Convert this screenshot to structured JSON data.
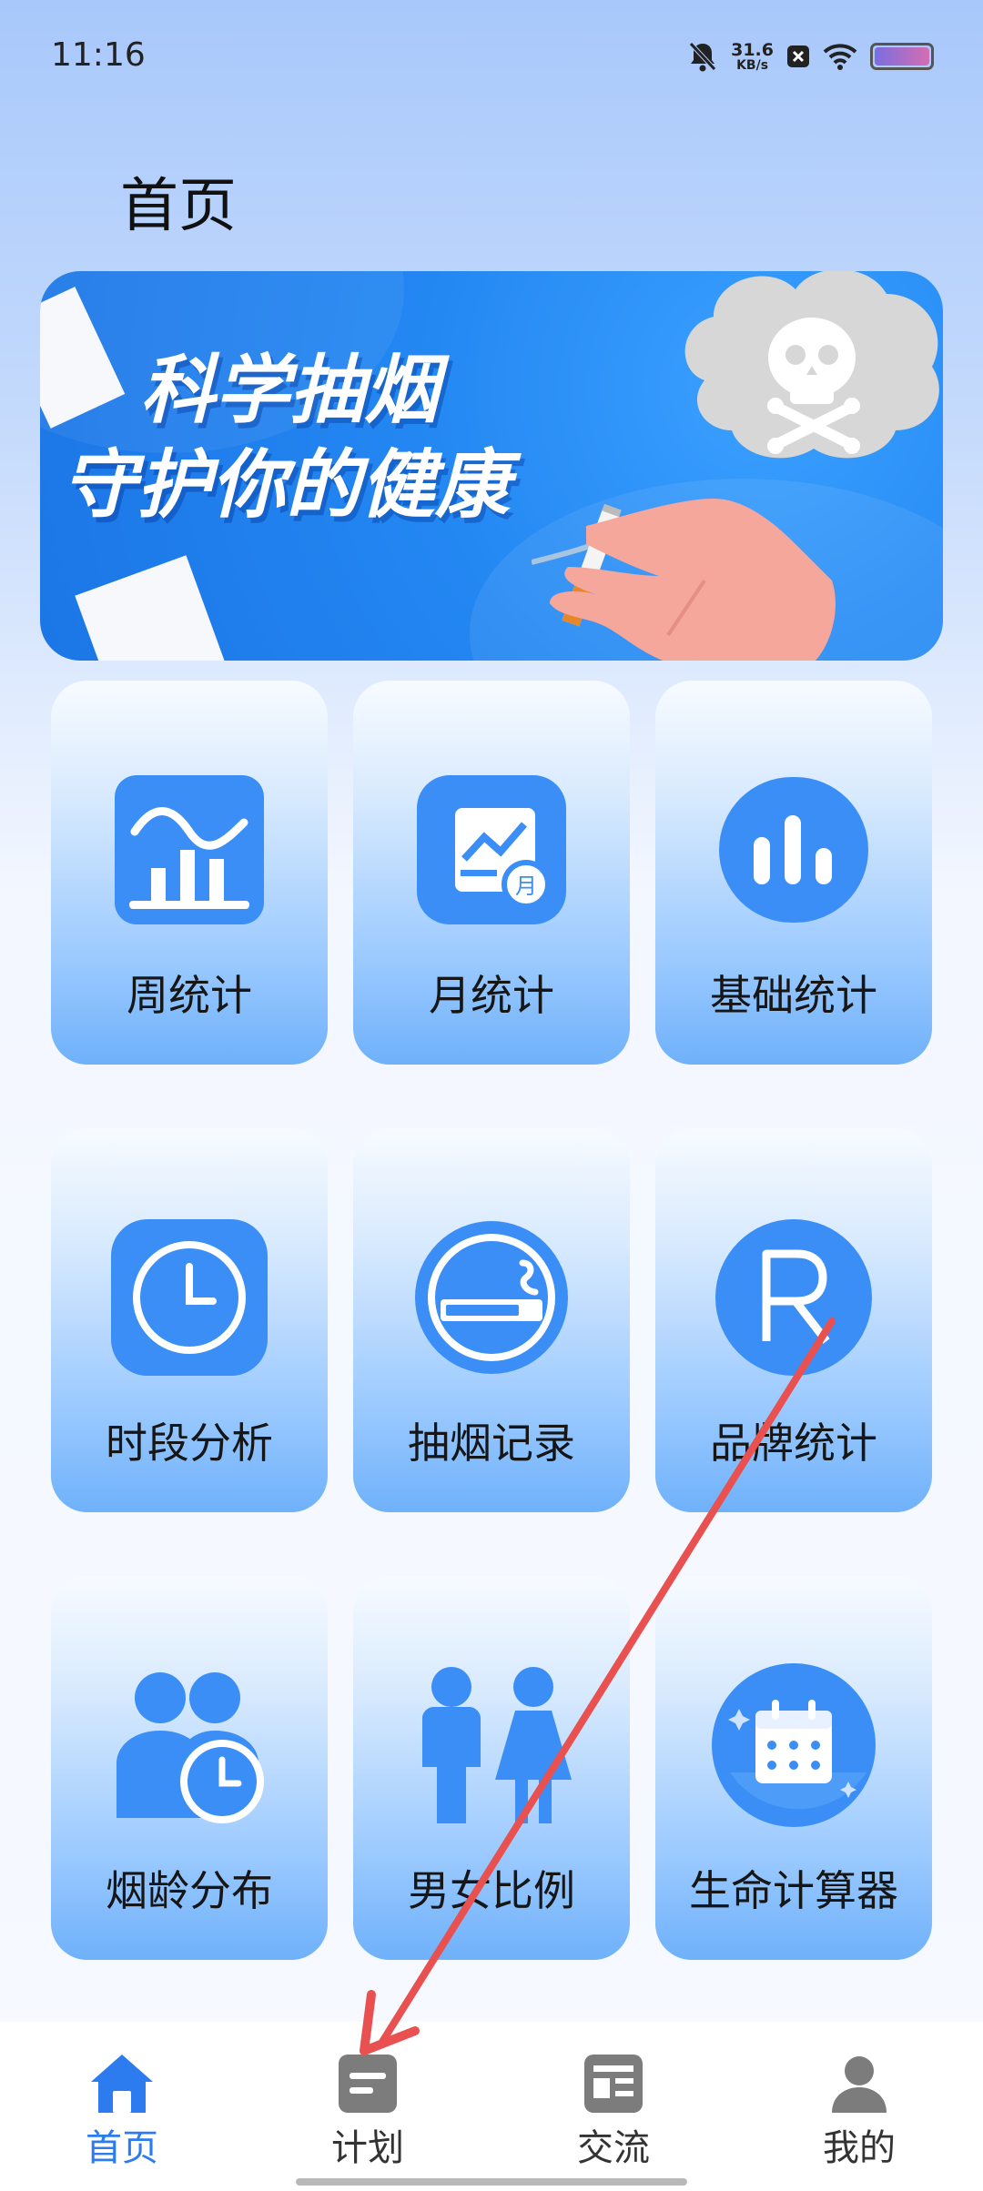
{
  "status_bar": {
    "time": "11:16",
    "net_speed_value": "31.6",
    "net_speed_unit": "KB/s",
    "icons": [
      "bell-muted-icon",
      "close-box-icon",
      "wifi-icon",
      "battery-icon"
    ]
  },
  "page": {
    "title": "首页"
  },
  "banner": {
    "line1": "科学抽烟",
    "line2": "守护你的健康"
  },
  "grid": {
    "items": [
      {
        "label": "周统计",
        "icon": "bar-line-chart-icon"
      },
      {
        "label": "月统计",
        "icon": "monthly-chart-icon"
      },
      {
        "label": "基础统计",
        "icon": "bar-chart-icon"
      },
      {
        "label": "时段分析",
        "icon": "clock-icon"
      },
      {
        "label": "抽烟记录",
        "icon": "cigarette-icon"
      },
      {
        "label": "品牌统计",
        "icon": "registered-mark-icon"
      },
      {
        "label": "烟龄分布",
        "icon": "people-clock-icon"
      },
      {
        "label": "男女比例",
        "icon": "male-female-icon"
      },
      {
        "label": "生命计算器",
        "icon": "calendar-icon"
      }
    ]
  },
  "bottom_nav": {
    "items": [
      {
        "label": "首页",
        "icon": "home-icon",
        "active": true
      },
      {
        "label": "计划",
        "icon": "plan-icon",
        "active": false
      },
      {
        "label": "交流",
        "icon": "news-icon",
        "active": false
      },
      {
        "label": "我的",
        "icon": "person-icon",
        "active": false
      }
    ]
  },
  "colors": {
    "accent": "#2c7cf0",
    "icon_blue": "#3a8ef5",
    "annotation_arrow": "#e8514f"
  }
}
